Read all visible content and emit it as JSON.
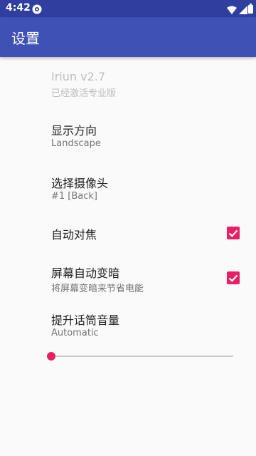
{
  "status_bar": {
    "time": "4:42",
    "icons": [
      "app-notification-icon",
      "wifi-icon",
      "cell-signal-icon",
      "battery-icon"
    ]
  },
  "app_bar": {
    "title": "设置"
  },
  "preferences": [
    {
      "title": "Iriun v2.7",
      "summary": "已经激活专业版",
      "enabled": false
    },
    {
      "title": "显示方向",
      "summary": "Landscape"
    },
    {
      "title": "选择摄像头",
      "summary": "#1 [Back]"
    },
    {
      "title": "自动对焦",
      "checked": true
    },
    {
      "title": "屏幕自动变暗",
      "summary": "将屏幕变暗来节省电能",
      "checked": true
    },
    {
      "title": "提升话筒音量",
      "summary": "Automatic",
      "slider_value": 0
    }
  ],
  "colors": {
    "status_bar": "#303f9f",
    "app_bar": "#3f51b5",
    "accent": "#e91e63",
    "background": "#fafafa"
  }
}
